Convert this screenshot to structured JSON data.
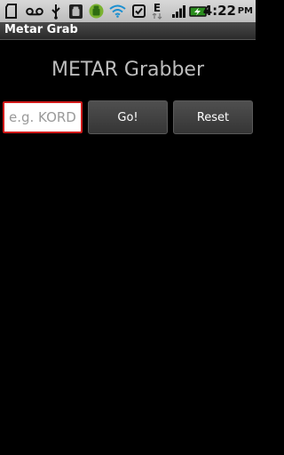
{
  "status_bar": {
    "time": "4:22",
    "ampm": "PM",
    "network": "E",
    "icons": [
      "sd-card-icon",
      "voicemail-icon",
      "usb-icon",
      "android-debug-icon",
      "android-update-icon",
      "wifi-icon",
      "checkbox-icon",
      "data-network-icon",
      "signal-icon",
      "battery-charging-icon"
    ]
  },
  "app": {
    "title": "Metar Grab"
  },
  "main": {
    "heading": "METAR Grabber",
    "station_input": {
      "value": "",
      "placeholder": "e.g. KORD"
    },
    "go_label": "Go!",
    "reset_label": "Reset"
  },
  "colors": {
    "input_focus_border": "#d21a1a",
    "heading": "#bdbdbd",
    "background": "#000000"
  }
}
